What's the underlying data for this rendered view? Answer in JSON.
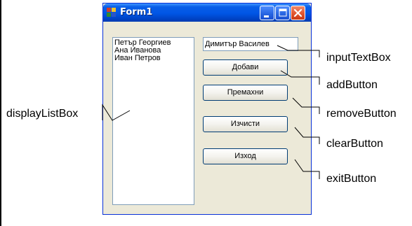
{
  "window": {
    "title": "Form1",
    "controls": [
      "minimize-icon",
      "maximize-icon",
      "close-icon"
    ],
    "accent": "#0055e5",
    "face": "#ece9d8"
  },
  "listbox": {
    "items": [
      "Петър Георгиев",
      "Ана Иванова",
      "Иван Петров"
    ]
  },
  "textbox": {
    "value": "Димитър Василев"
  },
  "buttons": {
    "add": "Добави",
    "remove": "Премахни",
    "clear": "Изчисти",
    "exit": "Изход"
  },
  "annotations": {
    "input": "inputTextBox",
    "add": "addButton",
    "remove": "removeButton",
    "clear": "clearButton",
    "exit": "exitButton",
    "display": "displayListBox"
  }
}
